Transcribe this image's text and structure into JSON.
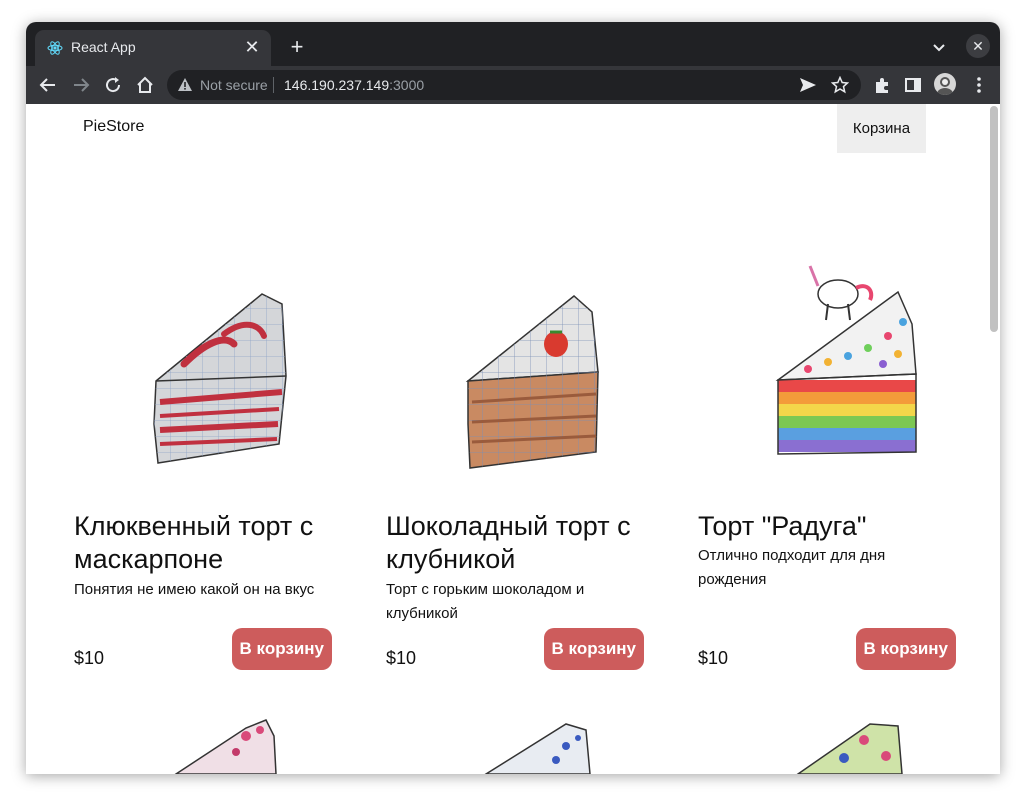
{
  "browser": {
    "tab_title": "React App",
    "new_tab_label": "+",
    "not_secure": "Not secure",
    "url_host": "146.190.237.149",
    "url_port": ":3000"
  },
  "store": {
    "brand": "PieStore",
    "cart_label": "Корзина",
    "accent_color": "#cd5c5c"
  },
  "products": [
    {
      "title": "Клюквенный торт с маскарпоне",
      "description": "Понятия не имею какой он на вкус",
      "price": "$10",
      "button": "В корзину",
      "image": "cake-slice-cranberry"
    },
    {
      "title": "Шоколадный торт с клубникой",
      "description": "Торт с горьким шоколадом и клубникой",
      "price": "$10",
      "button": "В корзину",
      "image": "cake-slice-chocolate-strawberry"
    },
    {
      "title": "Торт \"Радуга\"",
      "description": "Отлично подходит для дня рождения",
      "price": "$10",
      "button": "В корзину",
      "image": "cake-slice-rainbow-unicorn"
    }
  ]
}
